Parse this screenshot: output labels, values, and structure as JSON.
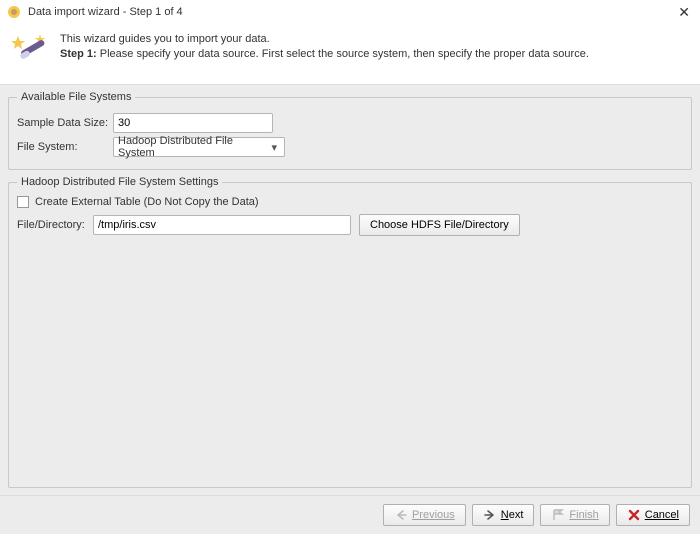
{
  "window": {
    "title": "Data import wizard - Step 1 of 4"
  },
  "header": {
    "line1": "This wizard guides you to import your data.",
    "step_label": "Step 1:",
    "step_text": "Please specify your data source. First select the source system, then specify the proper data source."
  },
  "available_fs": {
    "legend": "Available File Systems",
    "sample_size_label": "Sample Data Size:",
    "sample_size_value": "30",
    "file_system_label": "File System:",
    "file_system_value": "Hadoop Distributed File System"
  },
  "hdfs": {
    "legend": "Hadoop Distributed File System Settings",
    "create_external_label": "Create External Table (Do Not Copy the Data)",
    "create_external_checked": false,
    "file_dir_label": "File/Directory:",
    "file_dir_value": "/tmp/iris.csv",
    "choose_btn": "Choose HDFS File/Directory"
  },
  "footer": {
    "previous": "Previous",
    "next": "Next",
    "finish": "Finish",
    "cancel": "Cancel"
  }
}
